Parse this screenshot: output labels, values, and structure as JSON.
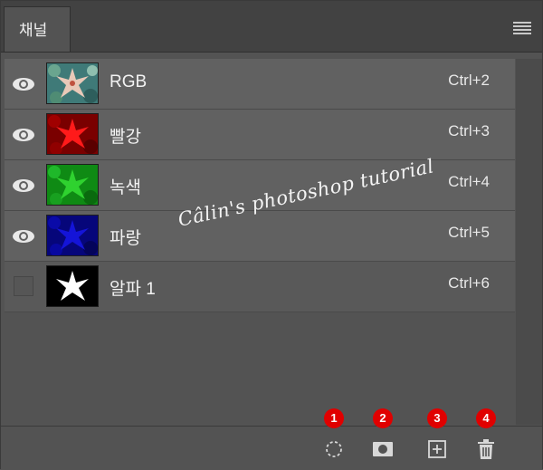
{
  "panel": {
    "tab_label": "채널",
    "menu_icon": "panel-menu-icon"
  },
  "channels": [
    {
      "name": "RGB",
      "shortcut": "Ctrl+2",
      "visible": true,
      "thumb": "rgb"
    },
    {
      "name": "빨강",
      "shortcut": "Ctrl+3",
      "visible": true,
      "thumb": "red"
    },
    {
      "name": "녹색",
      "shortcut": "Ctrl+4",
      "visible": true,
      "thumb": "green"
    },
    {
      "name": "파랑",
      "shortcut": "Ctrl+5",
      "visible": true,
      "thumb": "blue"
    },
    {
      "name": "알파 1",
      "shortcut": "Ctrl+6",
      "visible": false,
      "thumb": "alpha"
    }
  ],
  "watermark": "Câlin's photoshop tutorial",
  "footer": {
    "tools": [
      {
        "icon": "load-selection-icon",
        "badge": "1"
      },
      {
        "icon": "save-selection-mask-icon",
        "badge": "2"
      },
      {
        "icon": "new-channel-icon",
        "badge": "3"
      },
      {
        "icon": "delete-channel-icon",
        "badge": "4"
      }
    ],
    "badge_color": "#e00000"
  },
  "colors": {
    "panel_bg": "#535353",
    "row_bg": "#616161",
    "tab_bar_bg": "#424242"
  }
}
